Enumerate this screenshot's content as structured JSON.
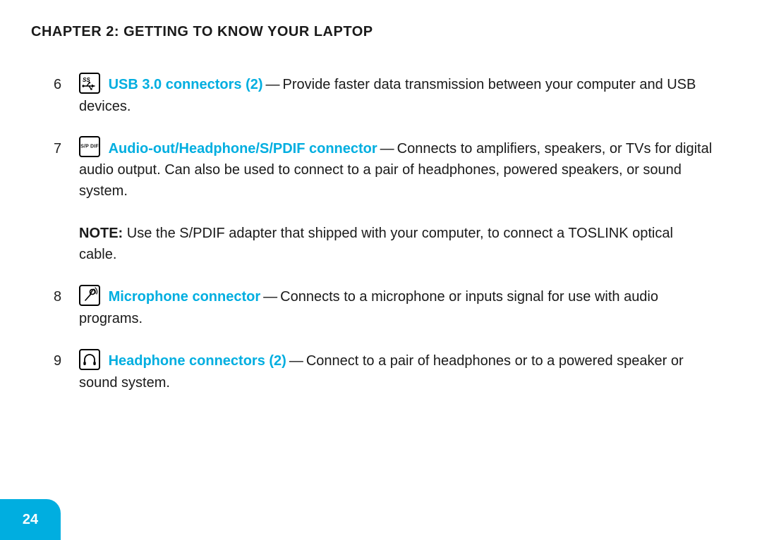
{
  "chapter_title": "CHAPTER 2: GETTING TO KNOW YOUR LAPTOP",
  "accent_color": "#00aee0",
  "page_number": "24",
  "entries": [
    {
      "num": "6",
      "icon": "usb3-icon",
      "icon_text": "SS",
      "term": "USB 3.0 connectors (2)",
      "desc": "Provide faster data transmission between your computer and USB devices."
    },
    {
      "num": "7",
      "icon": "spdif-icon",
      "icon_text": "S/P DIF",
      "term": "Audio-out/Headphone/S/PDIF connector",
      "desc": "Connects to amplifiers, speakers, or TVs for digital audio output. Can also be used to connect to a pair of headphones, powered speakers, or sound system."
    },
    {
      "num": "8",
      "icon": "microphone-icon",
      "icon_text": "",
      "term": "Microphone connector",
      "desc": "Connects to a microphone or inputs signal for use with audio programs."
    },
    {
      "num": "9",
      "icon": "headphone-icon",
      "icon_text": "",
      "term": "Headphone connectors (2)",
      "desc": "Connect to a pair of headphones or to a powered speaker or sound system."
    }
  ],
  "note": {
    "label": "NOTE:",
    "text": "Use the S/PDIF adapter that shipped with your computer, to connect a TOSLINK optical cable."
  }
}
